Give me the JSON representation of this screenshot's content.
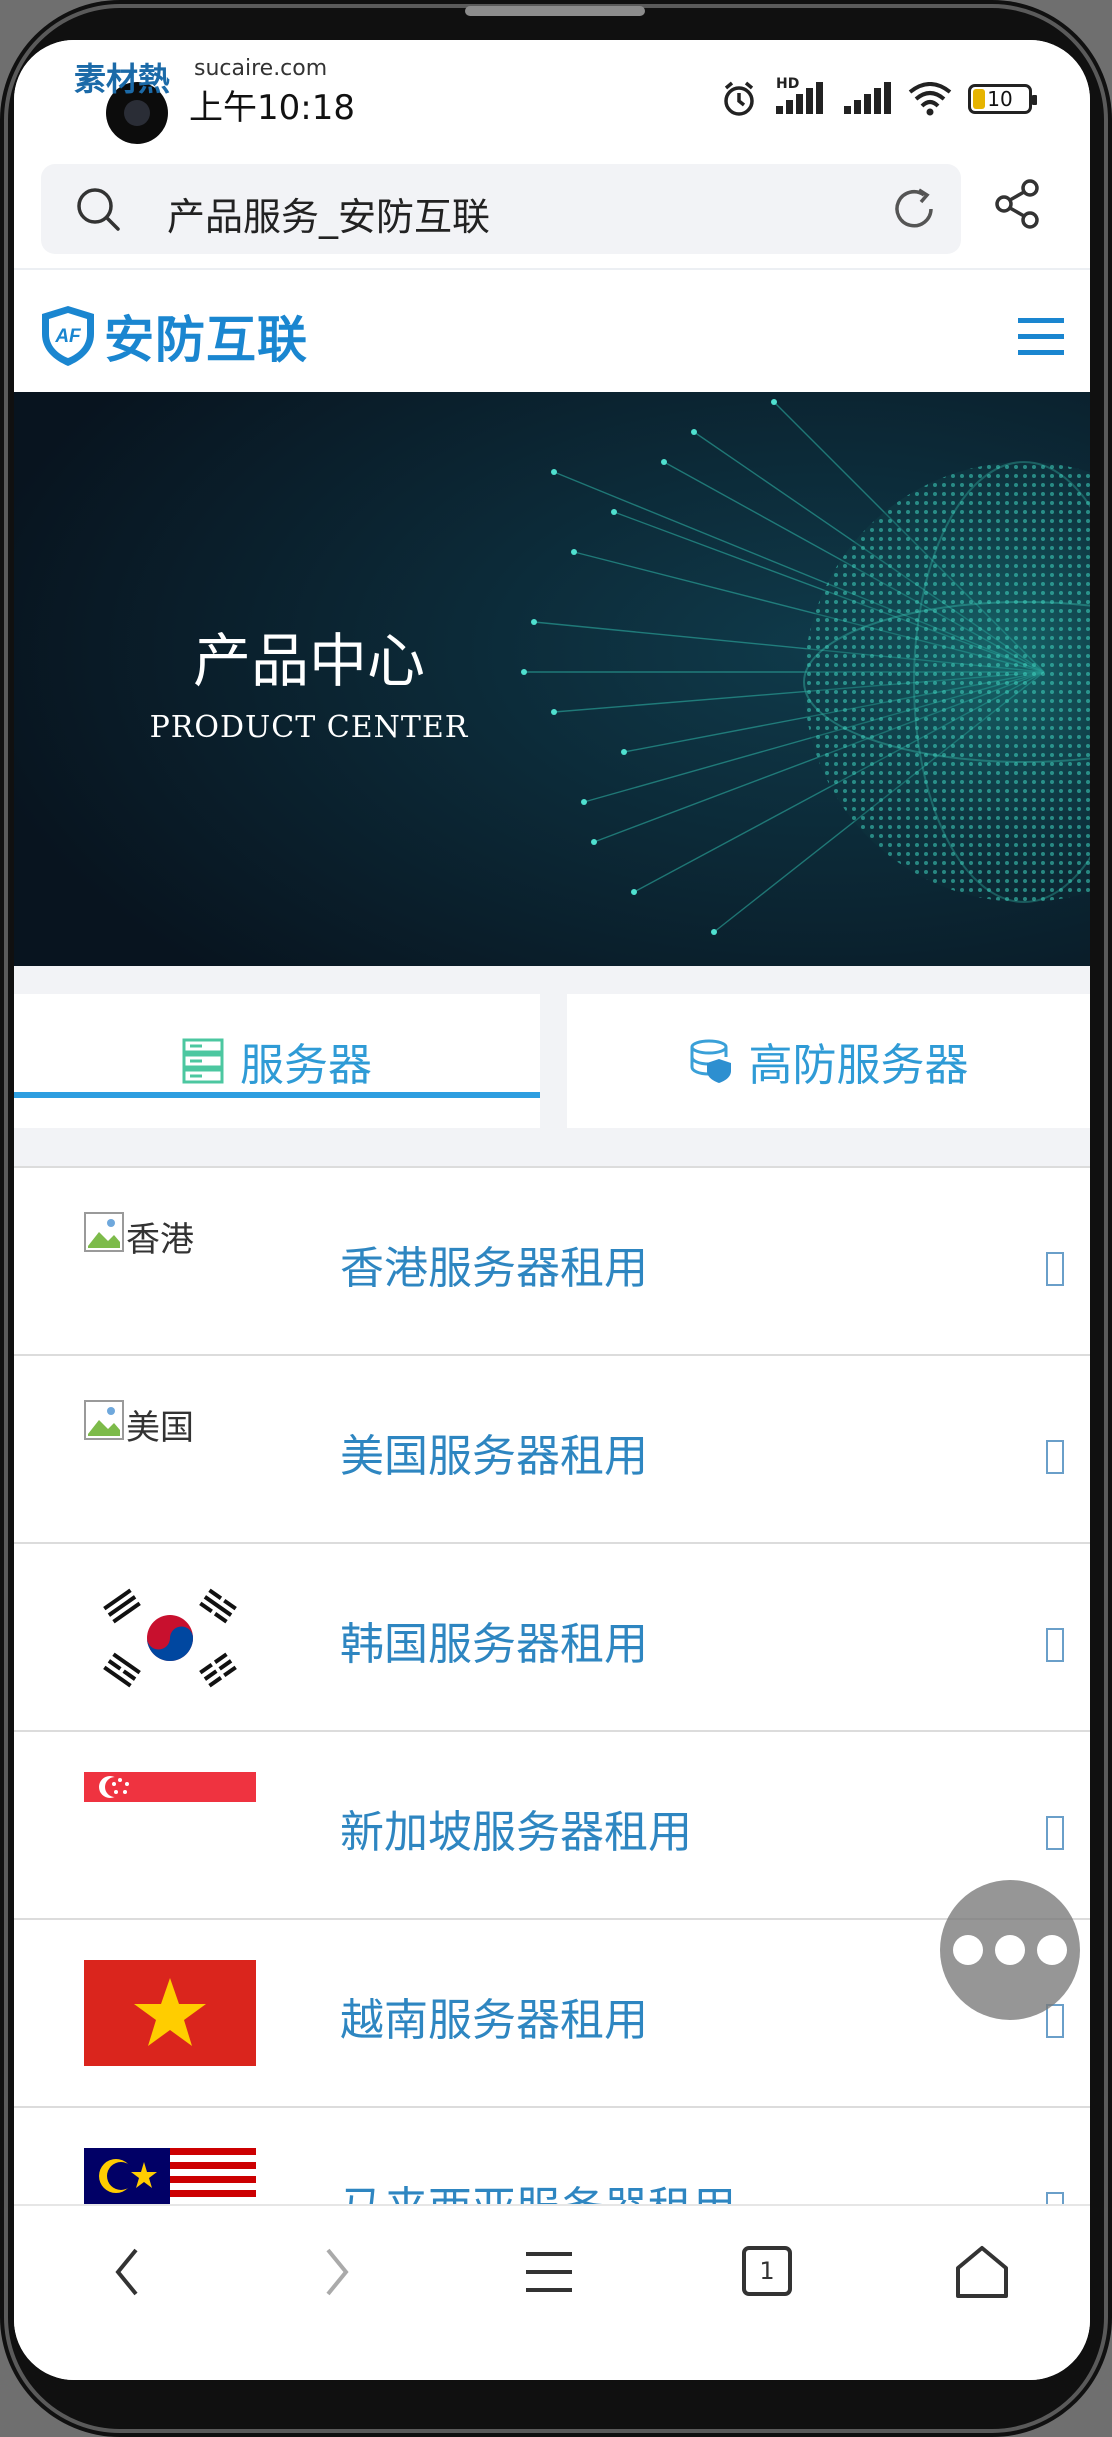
{
  "status_bar": {
    "watermark": "素材熱",
    "watermark_sub": "sucaire.com",
    "time": "上午10:18",
    "battery_level": "10",
    "network_label": "HD"
  },
  "browser": {
    "address_text": "产品服务_安防互联"
  },
  "site": {
    "logo_text": "安防互联",
    "logo_badge": "AF",
    "brand_color": "#1a86d0"
  },
  "banner": {
    "title": "产品中心",
    "subtitle": "PRODUCT CENTER"
  },
  "tabs": [
    {
      "label": "服务器",
      "icon": "server-icon",
      "active": true
    },
    {
      "label": "高防服务器",
      "icon": "shield-database-icon",
      "active": false
    }
  ],
  "products": [
    {
      "name": "香港服务器租用",
      "image_alt": "香港",
      "image": "broken"
    },
    {
      "name": "美国服务器租用",
      "image_alt": "美国",
      "image": "broken"
    },
    {
      "name": "韩国服务器租用",
      "image": "korea-flag"
    },
    {
      "name": "新加坡服务器租用",
      "image": "singapore-flag"
    },
    {
      "name": "越南服务器租用",
      "image": "vietnam-flag"
    },
    {
      "name": "马来西亚服务器租用",
      "image": "malaysia-flag"
    }
  ],
  "bottom_nav": [
    {
      "icon": "back-icon"
    },
    {
      "icon": "forward-icon"
    },
    {
      "icon": "menu-icon"
    },
    {
      "icon": "tabs-icon",
      "count": "1"
    },
    {
      "icon": "home-icon"
    }
  ]
}
